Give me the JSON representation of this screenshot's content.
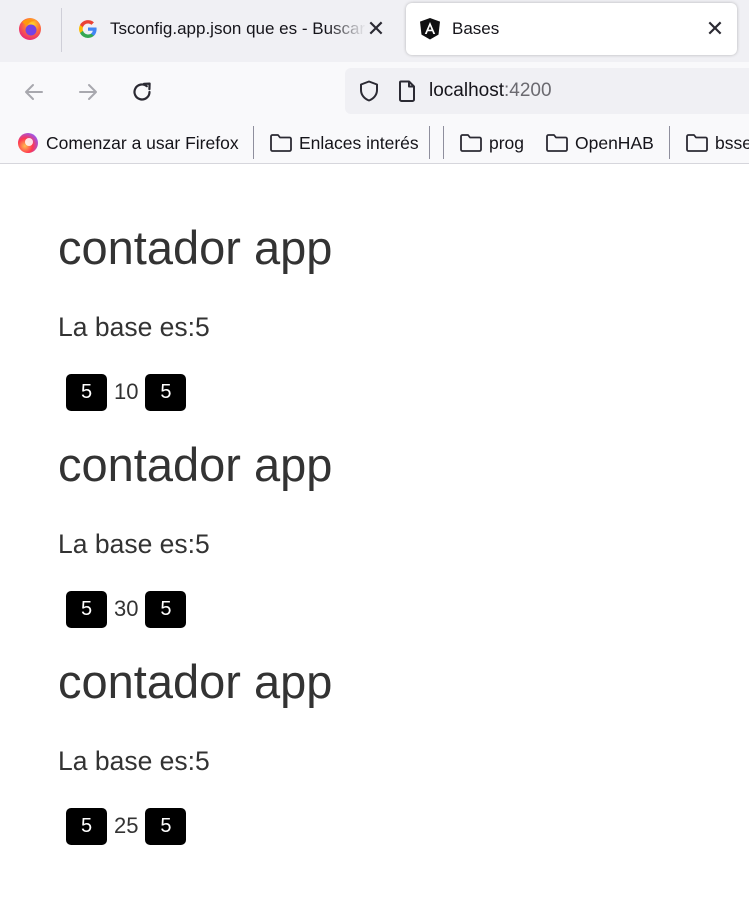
{
  "browser": {
    "tabs": [
      {
        "title": "Tsconfig.app.json que es - Buscar con Google",
        "favicon": "google-icon",
        "active": false
      },
      {
        "title": "Bases",
        "favicon": "angular-icon",
        "active": true
      }
    ],
    "url": {
      "host": "localhost",
      "port": ":4200"
    },
    "bookmarks": [
      {
        "label": "Comenzar a usar Firefox",
        "icon": "firefox-icon"
      },
      {
        "label": "Enlaces interés",
        "icon": "folder-icon"
      },
      {
        "label": "prog",
        "icon": "folder-icon"
      },
      {
        "label": "OpenHAB",
        "icon": "folder-icon"
      },
      {
        "label": "bsse",
        "icon": "folder-icon"
      }
    ]
  },
  "counters": [
    {
      "title": "contador app",
      "base_text": "La base es:5",
      "minus_label": "5",
      "value": "10",
      "plus_label": "5"
    },
    {
      "title": "contador app",
      "base_text": "La base es:5",
      "minus_label": "5",
      "value": "30",
      "plus_label": "5"
    },
    {
      "title": "contador app",
      "base_text": "La base es:5",
      "minus_label": "5",
      "value": "25",
      "plus_label": "5"
    }
  ],
  "colors": {
    "text": "#333333",
    "button_bg": "#000000",
    "button_text": "#ffffff",
    "tabstrip_bg": "#f0f0f4",
    "toolbar_bg": "#f9f9fb"
  }
}
